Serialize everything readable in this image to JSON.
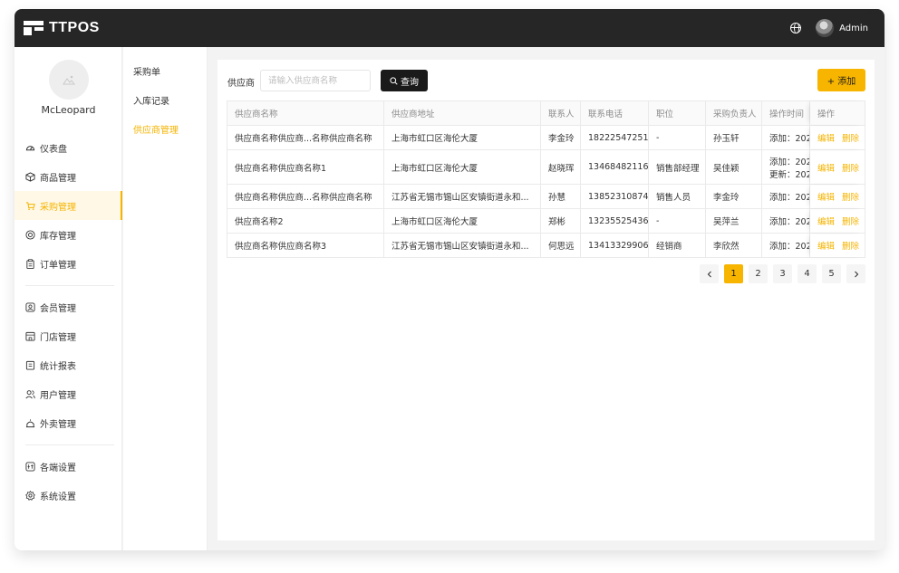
{
  "header": {
    "app_name": "TTPOS",
    "user_name": "Admin"
  },
  "profile": {
    "name": "McLeopard"
  },
  "sidebar": {
    "items": [
      {
        "label": "仪表盘",
        "icon": "dashboard-icon"
      },
      {
        "label": "商品管理",
        "icon": "box-icon"
      },
      {
        "label": "采购管理",
        "icon": "cart-icon",
        "active": true
      },
      {
        "label": "库存管理",
        "icon": "inventory-icon"
      },
      {
        "label": "订单管理",
        "icon": "clipboard-icon"
      },
      {
        "label": "会员管理",
        "icon": "member-icon"
      },
      {
        "label": "门店管理",
        "icon": "store-icon"
      },
      {
        "label": "统计报表",
        "icon": "report-icon"
      },
      {
        "label": "用户管理",
        "icon": "users-icon"
      },
      {
        "label": "外卖管理",
        "icon": "delivery-icon"
      },
      {
        "label": "各端设置",
        "icon": "devices-icon"
      },
      {
        "label": "系统设置",
        "icon": "gear-icon"
      }
    ]
  },
  "subnav": {
    "items": [
      {
        "label": "采购单"
      },
      {
        "label": "入库记录"
      },
      {
        "label": "供应商管理",
        "active": true
      }
    ]
  },
  "filter": {
    "label": "供应商",
    "placeholder": "请输入供应商名称",
    "query_label": "查询",
    "add_label": "+ 添加"
  },
  "table": {
    "columns": [
      "供应商名称",
      "供应商地址",
      "联系人",
      "联系电话",
      "职位",
      "采购负责人",
      "操作时间",
      "操作"
    ],
    "rows": [
      {
        "name": "供应商名称供应商...名称供应商名称",
        "address": "上海市虹口区海伦大厦",
        "contact": "李金玲",
        "phone": "18222547251",
        "position": "-",
        "buyer": "孙玉轩",
        "time1": "添加：202",
        "time2": "",
        "edit": "编辑",
        "delete": "删除"
      },
      {
        "name": "供应商名称供应商名称1",
        "address": "上海市虹口区海伦大厦",
        "contact": "赵晓珲",
        "phone": "13468482116",
        "position": "销售部经理",
        "buyer": "吴佳颖",
        "time1": "添加：202",
        "time2": "更新：202",
        "edit": "编辑",
        "delete": "删除"
      },
      {
        "name": "供应商名称供应商...名称供应商名称",
        "address": "江苏省无锡市锡山区安镇街道永和...",
        "contact": "孙慧",
        "phone": "13852310874",
        "position": "销售人员",
        "buyer": "李金玲",
        "time1": "添加：202",
        "time2": "",
        "edit": "编辑",
        "delete": "删除"
      },
      {
        "name": "供应商名称2",
        "address": "上海市虹口区海伦大厦",
        "contact": "郑彬",
        "phone": "13235525436",
        "position": "-",
        "buyer": "吴萍兰",
        "time1": "添加：202",
        "time2": "",
        "edit": "编辑",
        "delete": "删除"
      },
      {
        "name": "供应商名称供应商名称3",
        "address": "江苏省无锡市锡山区安镇街道永和...",
        "contact": "何思远",
        "phone": "13413329906",
        "position": "经销商",
        "buyer": "李欣然",
        "time1": "添加：202",
        "time2": "",
        "edit": "编辑",
        "delete": "删除"
      }
    ]
  },
  "pagination": {
    "pages": [
      "1",
      "2",
      "3",
      "4",
      "5"
    ],
    "current": "1"
  },
  "colors": {
    "accent": "#f7b500",
    "topbar": "#262626"
  }
}
